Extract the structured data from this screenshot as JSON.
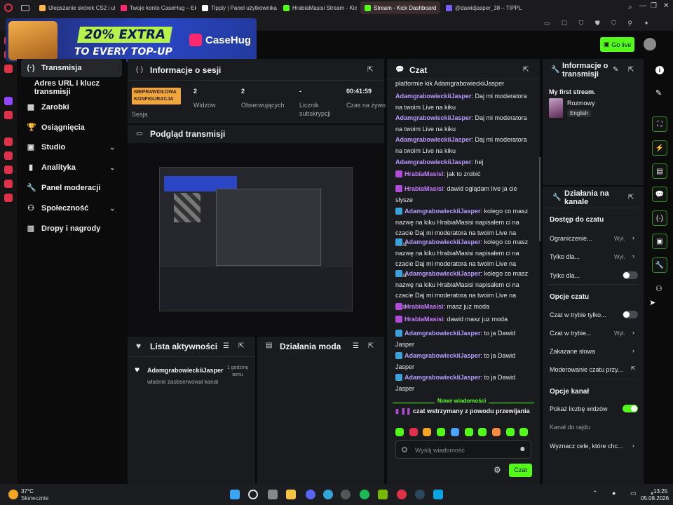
{
  "browser": {
    "tabs": [
      {
        "label": "Ulepszanie skórek CS2 i ul",
        "color": "#ffb84d"
      },
      {
        "label": "Twoje konto CaseHug – Ek",
        "color": "#ff2a6d"
      },
      {
        "label": "Tipply | Panel użytkownika",
        "color": "#ffffff"
      },
      {
        "label": "HrabiaMasisi Stream - Kic",
        "color": "#53fc18"
      },
      {
        "label": "Stream - Kick Dashboard",
        "color": "#53fc18"
      },
      {
        "label": "@dawidjasper_38 – TIPPLY",
        "color": "#7b5cff"
      }
    ],
    "active_tab": 4
  },
  "ad": {
    "extra": "20% EXTRA",
    "every": "TO EVERY TOP-UP",
    "brand": "CaseHug"
  },
  "header": {
    "go_live": "Go live"
  },
  "sidebar": {
    "items": [
      {
        "label": "Transmisja",
        "icon": "(·)"
      },
      {
        "label": "Adres URL i klucz transmisji",
        "icon": ""
      },
      {
        "label": "Zarobki",
        "icon": "▦"
      },
      {
        "label": "Osiągnięcia",
        "icon": "🏆"
      },
      {
        "label": "Studio",
        "icon": "▣"
      },
      {
        "label": "Analityka",
        "icon": "▮"
      },
      {
        "label": "Panel moderacji",
        "icon": "🔧"
      },
      {
        "label": "Społeczność",
        "icon": "⚇"
      },
      {
        "label": "Dropy i nagrody",
        "icon": "▥"
      }
    ]
  },
  "session": {
    "title": "Informacje o sesji",
    "badge": "NIEPRAWIDŁOWA KONFIGURACJA",
    "badge_caption": "Sesja",
    "stats": [
      {
        "value": "2",
        "label": "Widzów"
      },
      {
        "value": "2",
        "label": "Obserwujących"
      },
      {
        "value": "-",
        "label": "Licznik subskrypcji"
      },
      {
        "value": "00:41:59",
        "label": "Czas na żywo"
      }
    ]
  },
  "preview": {
    "title": "Podgląd transmisji"
  },
  "activity": {
    "title": "Lista aktywności",
    "items": [
      {
        "user": "AdamgrabowieckiiJasper",
        "text": "właśnie zaobserwował kanał",
        "time": "1 godzinę temu"
      }
    ]
  },
  "mod_actions": {
    "title": "Działania moda"
  },
  "chat": {
    "title": "Czat",
    "top_text": "platformie kik AdamgrabowieckiiJasper",
    "messages": [
      {
        "user": "AdamgrabowieckiiJasper",
        "text": ": Daj mi moderatora na twoim Live na kiku",
        "color": "#b59cff",
        "badge": ""
      },
      {
        "user": "AdamgrabowieckiiJasper",
        "text": ": Daj mi moderatora na twoim Live na kiku",
        "color": "#b59cff",
        "badge": ""
      },
      {
        "user": "AdamgrabowieckiiJasper",
        "text": ": Daj mi moderatora na twoim Live na kiku",
        "color": "#b59cff",
        "badge": ""
      },
      {
        "user": "AdamgrabowieckiiJasper",
        "text": ": hej",
        "color": "#b59cff",
        "badge": ""
      },
      {
        "user": "HrabiaMasisi",
        "text": ": jak to zrobić",
        "color": "#c77dff",
        "badge": "#b14cd9"
      },
      {
        "user": "HrabiaMasisi",
        "text": ": dawid oglądam live ja cie słysze",
        "color": "#c77dff",
        "badge": "#b14cd9"
      },
      {
        "user": "AdamgrabowieckiiJasper",
        "text": ": kolego co masz nazwę na kiku HrabiaMasisi napisałem ci na czacie Daj mi moderatora na twoim Live na kiku",
        "color": "#b59cff",
        "badge": "#3aa1d9"
      },
      {
        "user": "AdamgrabowieckiiJasper",
        "text": ": kolego co masz nazwę na kiku HrabiaMasisi napisałem ci na czacie Daj mi moderatora na twoim Live na kiku",
        "color": "#b59cff",
        "badge": "#3aa1d9"
      },
      {
        "user": "AdamgrabowieckiiJasper",
        "text": ": kolego co masz nazwę na kiku HrabiaMasisi napisałem ci na czacie Daj mi moderatora na twoim Live na kiku",
        "color": "#b59cff",
        "badge": "#3aa1d9"
      },
      {
        "user": "HrabiaMasisi",
        "text": ": masz juz moda",
        "color": "#c77dff",
        "badge": "#b14cd9"
      },
      {
        "user": "HrabiaMasisi",
        "text": ": dawid masz juz moda",
        "color": "#c77dff",
        "badge": "#b14cd9"
      },
      {
        "user": "AdamgrabowieckiiJasper",
        "text": ": to ja Dawid Jasper",
        "color": "#b59cff",
        "badge": "#3aa1d9"
      },
      {
        "user": "AdamgrabowieckiiJasper",
        "text": ": to ja Dawid Jasper",
        "color": "#b59cff",
        "badge": "#3aa1d9"
      },
      {
        "user": "AdamgrabowieckiiJasper",
        "text": ": to ja Dawid Jasper",
        "color": "#b59cff",
        "badge": "#3aa1d9"
      }
    ],
    "new_messages": "Nowe wiadomości",
    "paused": "czat wstrzymany z powodu przewijania",
    "input_placeholder": "Wyślij wiadomość",
    "send_label": "Czat"
  },
  "stream_info": {
    "title": "Informacje o transmisji",
    "stream_title": "My first stream.",
    "category": "Rozmowy",
    "language": "English"
  },
  "channel_actions": {
    "title": "Działania na kanale",
    "chat_access": "Dostęp do czatu",
    "row1": {
      "label": "Ograniczenie...",
      "value": "Wył."
    },
    "row2": {
      "label": "Tylko dla...",
      "value": "Wył."
    },
    "row3": {
      "label": "Tylko dla..."
    },
    "chat_options": "Opcje czatu",
    "row4": {
      "label": "Czat w trybie tylko..."
    },
    "row5": {
      "label": "Czat w trybie...",
      "value": "Wył."
    },
    "row6": {
      "label": "Zakazane słowa"
    },
    "row7": {
      "label": "Moderowanie czatu przy..."
    },
    "channel_options": "Opcje kanał",
    "row8": {
      "label": "Pokaż liczbę widzów"
    },
    "row9": {
      "label": "Kanał do rajdu"
    },
    "row10": {
      "label": "Wyznacz cele, które chc..."
    }
  },
  "taskbar": {
    "temp": "37°C",
    "weather": "Słonecznie",
    "time": "13:25",
    "date": "05.08.2026"
  }
}
